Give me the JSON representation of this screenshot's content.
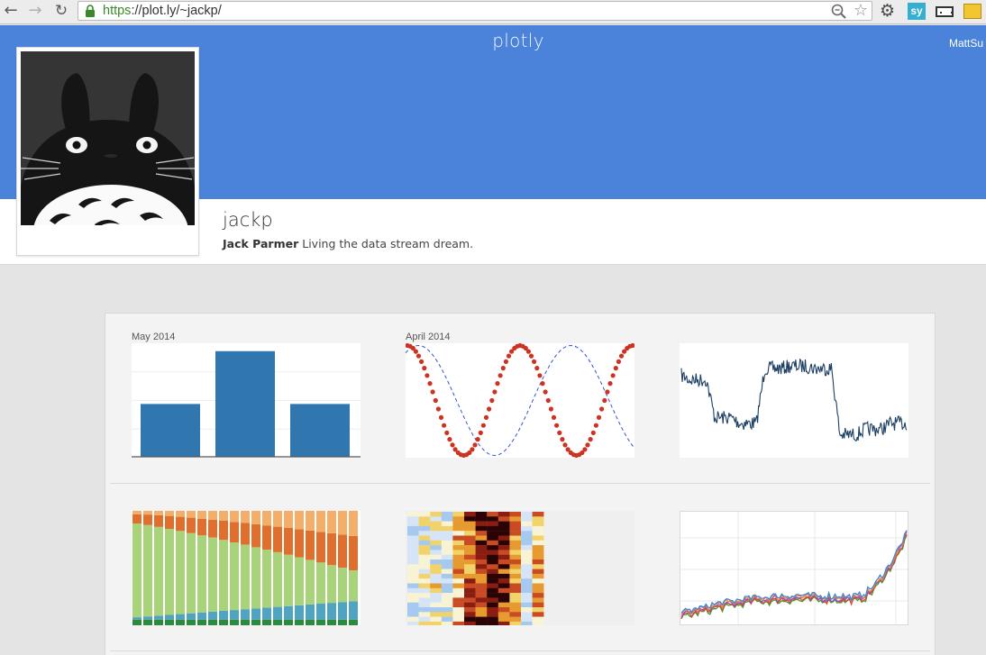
{
  "browser": {
    "url_scheme": "https",
    "url_rest": "://plot.ly/~jackp/",
    "extension_sy": "sy",
    "icons": [
      "back-arrow-icon",
      "forward-arrow-icon",
      "reload-icon",
      "lock-icon",
      "zoom-icon",
      "star-icon",
      "gear-icon",
      "ruler-icon",
      "yellow-extension-icon"
    ]
  },
  "header": {
    "logo": "plotly",
    "user_menu": "MattSu",
    "color": "#4a83d9"
  },
  "profile": {
    "username": "jackp",
    "full_name": "Jack Parmer",
    "bio": "Living the data stream dream."
  },
  "plots": [
    {
      "date_label": "May 2014",
      "chart_data": {
        "type": "bar",
        "values": [
          3,
          6,
          3
        ],
        "ylim": [
          0,
          6.5
        ],
        "color": "#3077b0"
      }
    },
    {
      "date_label": "April 2014",
      "chart_data": {
        "type": "line",
        "series": [
          {
            "mode": "markers",
            "color": "#cc3322",
            "amplitude": 1,
            "periods": 2,
            "phase": "cos"
          },
          {
            "mode": "dashed-line",
            "color": "#3355cc",
            "amplitude": 1,
            "periods": 1.5,
            "phase": "sin"
          }
        ]
      }
    },
    {
      "date_label": "",
      "chart_data": {
        "type": "line",
        "color": "#1c3f63",
        "levels": [
          0.72,
          0.68,
          0.35,
          0.3,
          0.78,
          0.8,
          0.78,
          0.2,
          0.25,
          0.3
        ]
      }
    },
    {
      "date_label": "",
      "chart_data": {
        "type": "bar",
        "stacked": true,
        "colors": [
          "#2d8a3c",
          "#4fa4c2",
          "#a8d37a",
          "#e06f2e",
          "#f3ae6a"
        ]
      }
    },
    {
      "date_label": "",
      "chart_data": {
        "type": "heatmap",
        "colors": [
          "#a6c9f0",
          "#d5e5f7",
          "#f8f3d4",
          "#f2d36a",
          "#e69a2f",
          "#c94b24",
          "#8a1d12",
          "#2a0404"
        ]
      }
    },
    {
      "date_label": "",
      "chart_data": {
        "type": "line",
        "colors": [
          "#3ea12d",
          "#e3412e",
          "#8a4fd0",
          "#f0892f",
          "#3c86d6"
        ]
      }
    }
  ]
}
